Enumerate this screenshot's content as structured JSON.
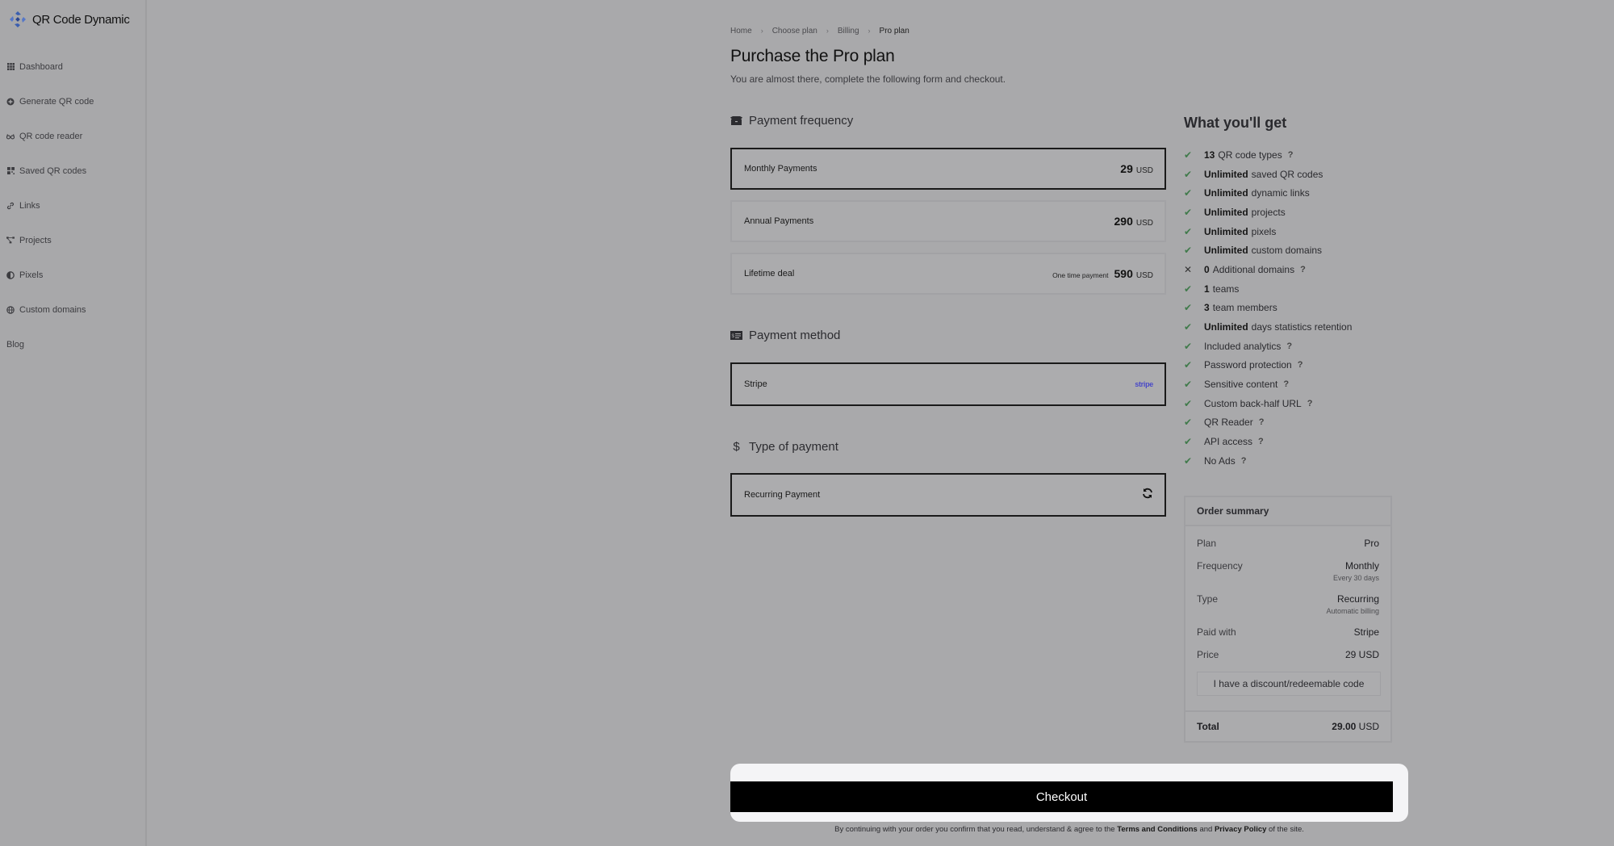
{
  "app": {
    "name": "QR Code Dynamic"
  },
  "sidebar": {
    "items": [
      {
        "label": "Dashboard",
        "icon": "grid-icon"
      },
      {
        "label": "Generate QR code",
        "icon": "plus-circle-icon"
      },
      {
        "label": "QR code reader",
        "icon": "glasses-icon"
      },
      {
        "label": "Saved QR codes",
        "icon": "qr-icon"
      },
      {
        "label": "Links",
        "icon": "link-icon"
      },
      {
        "label": "Projects",
        "icon": "project-diagram-icon"
      },
      {
        "label": "Pixels",
        "icon": "adjust-icon"
      },
      {
        "label": "Custom domains",
        "icon": "globe-icon"
      },
      {
        "label": "Blog",
        "icon": ""
      }
    ]
  },
  "breadcrumb": [
    "Home",
    "Choose plan",
    "Billing",
    "Pro plan"
  ],
  "header": {
    "title": "Purchase the Pro plan",
    "subtitle": "You are almost there, complete the following form and checkout."
  },
  "frequency": {
    "title": "Payment frequency",
    "options": [
      {
        "label": "Monthly Payments",
        "note": "",
        "amount": "29",
        "currency": "USD",
        "selected": true
      },
      {
        "label": "Annual Payments",
        "note": "",
        "amount": "290",
        "currency": "USD",
        "selected": false
      },
      {
        "label": "Lifetime deal",
        "note": "One time payment",
        "amount": "590",
        "currency": "USD",
        "selected": false
      }
    ]
  },
  "method": {
    "title": "Payment method",
    "options": [
      {
        "label": "Stripe",
        "logo_text": "stripe",
        "selected": true
      }
    ]
  },
  "type": {
    "title": "Type of payment",
    "options": [
      {
        "label": "Recurring Payment",
        "icon": "sync-icon",
        "selected": true
      }
    ]
  },
  "features": {
    "title": "What you'll get",
    "items": [
      {
        "included": true,
        "bold": "13",
        "text": "QR code types",
        "help": true
      },
      {
        "included": true,
        "bold": "Unlimited",
        "text": "saved QR codes",
        "help": false
      },
      {
        "included": true,
        "bold": "Unlimited",
        "text": "dynamic links",
        "help": false
      },
      {
        "included": true,
        "bold": "Unlimited",
        "text": "projects",
        "help": false
      },
      {
        "included": true,
        "bold": "Unlimited",
        "text": "pixels",
        "help": false
      },
      {
        "included": true,
        "bold": "Unlimited",
        "text": "custom domains",
        "help": false
      },
      {
        "included": false,
        "bold": "0",
        "text": "Additional domains",
        "help": true
      },
      {
        "included": true,
        "bold": "1",
        "text": "teams",
        "help": false
      },
      {
        "included": true,
        "bold": "3",
        "text": "team members",
        "help": false
      },
      {
        "included": true,
        "bold": "Unlimited",
        "text": "days statistics retention",
        "help": false
      },
      {
        "included": true,
        "bold": "",
        "text": "Included analytics",
        "help": true
      },
      {
        "included": true,
        "bold": "",
        "text": "Password protection",
        "help": true
      },
      {
        "included": true,
        "bold": "",
        "text": "Sensitive content",
        "help": true
      },
      {
        "included": true,
        "bold": "",
        "text": "Custom back-half URL",
        "help": true
      },
      {
        "included": true,
        "bold": "",
        "text": "QR Reader",
        "help": true
      },
      {
        "included": true,
        "bold": "",
        "text": "API access",
        "help": true
      },
      {
        "included": true,
        "bold": "",
        "text": "No Ads",
        "help": true
      }
    ]
  },
  "summary": {
    "title": "Order summary",
    "rows": [
      {
        "label": "Plan",
        "value": "Pro",
        "sub": ""
      },
      {
        "label": "Frequency",
        "value": "Monthly",
        "sub": "Every 30 days"
      },
      {
        "label": "Type",
        "value": "Recurring",
        "sub": "Automatic billing"
      },
      {
        "label": "Paid with",
        "value": "Stripe",
        "sub": ""
      },
      {
        "label": "Price",
        "value": "29 USD",
        "sub": ""
      }
    ],
    "discount_label": "I have a discount/redeemable code",
    "total_label": "Total",
    "total_amount": "29.00",
    "total_currency": "USD"
  },
  "checkout": {
    "button_label": "Checkout",
    "legal_prefix": "By continuing with your order you confirm that you read, understand & agree to the",
    "terms_link": "Terms and Conditions",
    "and": "and",
    "privacy_link": "Privacy Policy",
    "legal_suffix": "of the site."
  },
  "colors": {
    "check": "#3f7a4a",
    "stripe": "#4a4ac8",
    "checkout_bg": "#000000"
  }
}
